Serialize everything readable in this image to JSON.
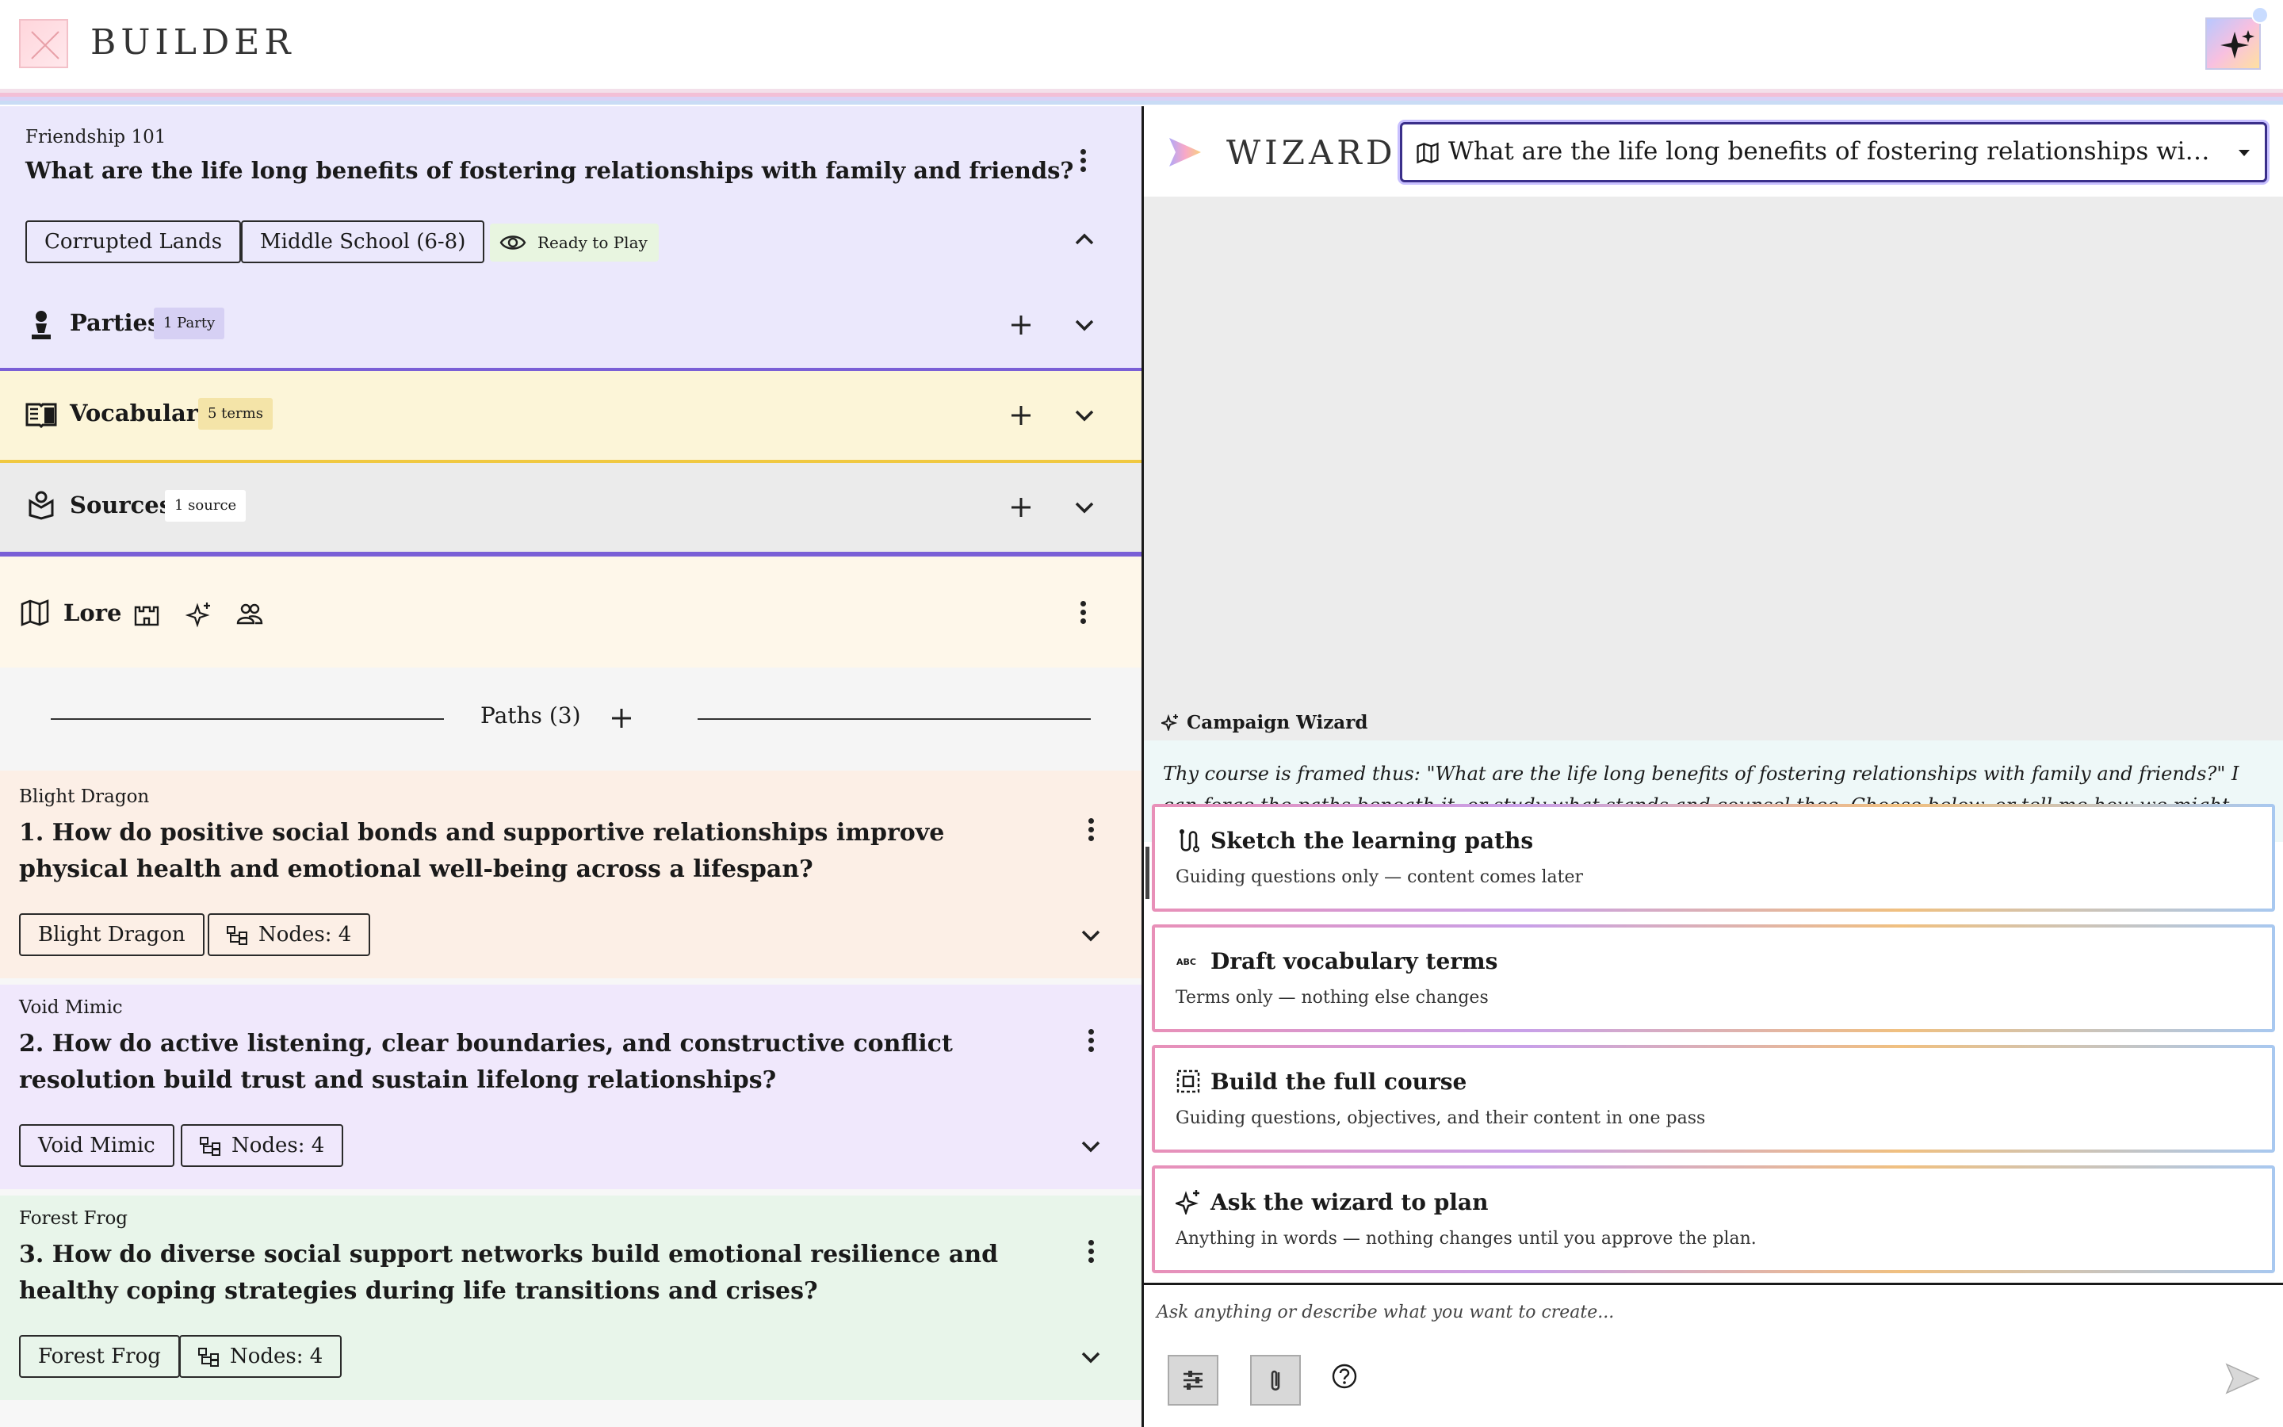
{
  "app": {
    "brand": "BUILDER"
  },
  "course": {
    "name": "Friendship 101",
    "question": "What are the life long benefits of fostering relationships with family and friends?",
    "tags": [
      "Corrupted Lands",
      "Middle School (6-8)"
    ],
    "status": "Ready to Play"
  },
  "sections": {
    "parties": {
      "label": "Parties",
      "badge": "1 Party"
    },
    "vocabulary": {
      "label": "Vocabulary",
      "badge": "5 terms"
    },
    "sources": {
      "label": "Sources",
      "badge": "1 source"
    },
    "lore": {
      "label": "Lore"
    }
  },
  "paths": {
    "header": "Paths (3)",
    "items": [
      {
        "monster": "Blight Dragon",
        "question": "1. How do positive social bonds and supportive relationships improve physical health and emotional well-being across a lifespan?",
        "chip": "Blight Dragon",
        "nodes": "Nodes: 4"
      },
      {
        "monster": "Void Mimic",
        "question": "2. How do active listening, clear boundaries, and constructive conflict resolution build trust and sustain lifelong relationships?",
        "chip": "Void Mimic",
        "nodes": "Nodes: 4"
      },
      {
        "monster": "Forest Frog",
        "question": "3. How do diverse social support networks build emotional resilience and healthy coping strategies during life transitions and crises?",
        "chip": "Forest Frog",
        "nodes": "Nodes: 4"
      }
    ]
  },
  "wizard": {
    "title": "WIZARD",
    "selected": "What are the life long benefits of fostering relationships with family and friends?",
    "assistant_label": "Campaign Wizard",
    "message": "Thy course is framed thus: \"What are the life long benefits of fostering relationships with family and friends?\" I can forge the paths beneath it, or study what stands and counsel thee. Choose below, or tell me how we might strengthen the frame.",
    "options": [
      {
        "title": "Sketch the learning paths",
        "desc": "Guiding questions only — content comes later",
        "icon": "path-icon"
      },
      {
        "title": "Draft vocabulary terms",
        "desc": "Terms only — nothing else changes",
        "icon": "abc-icon"
      },
      {
        "title": "Build the full course",
        "desc": "Guiding questions, objectives, and their content in one pass",
        "icon": "build-icon"
      },
      {
        "title": "Ask the wizard to plan",
        "desc": "Anything in words — nothing changes until you approve the plan.",
        "icon": "sparkle-icon"
      }
    ],
    "input_placeholder": "Ask anything or describe what you want to create..."
  },
  "colors": {
    "course_bg": "#ebe8fc",
    "vocab_bg": "#fcf5d8",
    "sources_bg": "#ebebeb",
    "lore_bg": "#fef7ea",
    "path1_bg": "#fcefe6",
    "path2_bg": "#f0e8fc",
    "path3_bg": "#e8f5ea",
    "accent": "#7a5fd6"
  }
}
